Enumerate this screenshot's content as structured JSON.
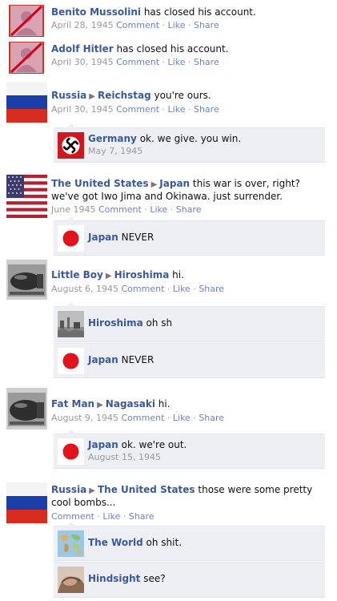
{
  "feed": {
    "post1": {
      "name": "Benito Mussolini",
      "text": "has closed his account.",
      "date": "April 28, 1945",
      "comment": "Comment",
      "like": "Like",
      "share": "Share"
    },
    "post2": {
      "name": "Adolf Hitler",
      "text": "has closed his account.",
      "date": "April 30, 1945",
      "comment": "Comment",
      "like": "Like",
      "share": "Share"
    },
    "post3": {
      "name": "Russia",
      "target": "Reichstag",
      "text": "you're ours.",
      "date": "April 30, 1945",
      "comment": "Comment",
      "like": "Like",
      "share": "Share",
      "comments": [
        {
          "name": "Germany",
          "text": "ok. we give. you win.",
          "date": "May 7, 1945"
        }
      ]
    },
    "post4": {
      "name": "The United States",
      "target": "Japan",
      "text": "this war is over, right? we've got Iwo Jima and Okinawa. just surrender.",
      "date": "June 1945",
      "comment": "Comment",
      "like": "Like",
      "share": "Share",
      "comments": [
        {
          "name": "Japan",
          "text": "NEVER"
        }
      ]
    },
    "post5": {
      "name": "Little Boy",
      "target": "Hiroshima",
      "text": "hi.",
      "date": "August 6, 1945",
      "comment": "Comment",
      "like": "Like",
      "share": "Share",
      "comments": [
        {
          "name": "Hiroshima",
          "text": "oh sh"
        },
        {
          "name": "Japan",
          "text": "NEVER"
        }
      ]
    },
    "post6": {
      "name": "Fat Man",
      "target": "Nagasaki",
      "text": "hi.",
      "date": "August 9, 1945",
      "comment": "Comment",
      "like": "Like",
      "share": "Share",
      "comments": [
        {
          "name": "Japan",
          "text": "ok. we're out.",
          "date": "August 15, 1945"
        }
      ]
    },
    "post7": {
      "name": "Russia",
      "target": "The United States",
      "text": "those were some pretty cool bombs...",
      "comment": "Comment",
      "like": "Like",
      "share": "Share",
      "comments": [
        {
          "name": "The World",
          "text": "oh shit."
        },
        {
          "name": "Hindsight",
          "text": "see?"
        }
      ]
    }
  },
  "separators": {
    "dot": "·",
    "arrow": "▶"
  },
  "icons": {
    "closed_account": "closed-account-avatar-icon",
    "russia": "russia-flag-icon",
    "germany": "swastika-flag-icon",
    "usa": "usa-flag-icon",
    "japan": "japan-flag-icon",
    "bomb": "atomic-bomb-photo-icon",
    "hiroshima": "hiroshima-ruins-photo-icon",
    "world": "world-map-icon",
    "hindsight": "hindsight-avatar-icon"
  },
  "colors": {
    "link": "#3b5998",
    "meta_link": "#6d84b4",
    "comment_bg": "#edeff4",
    "japan_red": "#e0131a",
    "russia_blue": "#1b3fa8",
    "russia_red": "#d62b1e",
    "usa_red": "#b22234",
    "usa_blue": "#3c3b6e"
  }
}
